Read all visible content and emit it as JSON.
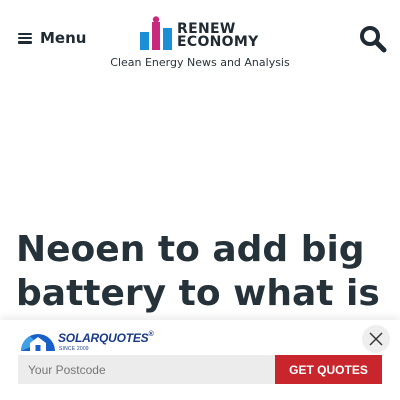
{
  "header": {
    "menu_label": "Menu",
    "logo": {
      "line1": "RENEW",
      "line2": "ECONOMY",
      "colors": {
        "blue": "#1a8fd8",
        "magenta": "#c8287e",
        "text": "#1f2a33"
      }
    },
    "tagline": "Clean Energy News and Analysis",
    "search_icon": "search-icon"
  },
  "article": {
    "headline": "Neoen to add big battery to what is"
  },
  "banner": {
    "brand": "SOLARQUOTES",
    "brand_mark": "®",
    "since": "SINCE 2009",
    "postcode_placeholder": "Your Postcode",
    "postcode_value": "",
    "cta_label": "GET QUOTES",
    "colors": {
      "cta": "#c8262c",
      "brand": "#1a3a8c"
    }
  }
}
